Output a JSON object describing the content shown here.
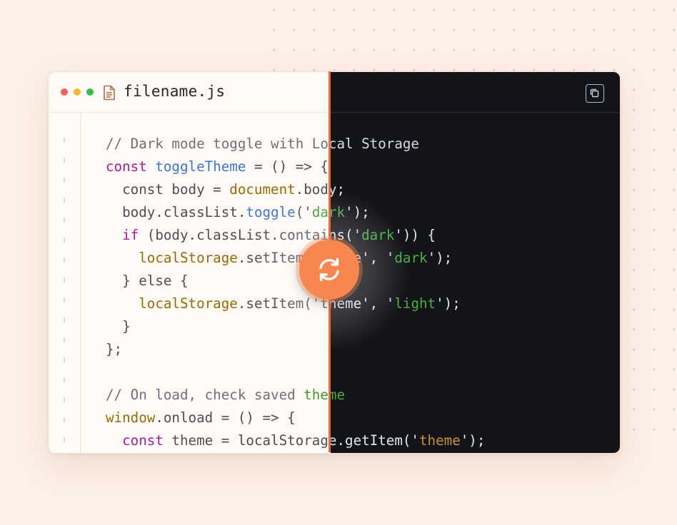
{
  "window": {
    "filename": "filename.js",
    "file_icon": "file-icon",
    "copy_icon": "copy-icon",
    "traffic_lights": [
      "#f0625a",
      "#f5b533",
      "#2fbf55"
    ]
  },
  "toggle": {
    "icon": "refresh-icon",
    "color": "#f8874f",
    "divider_color": "#f06a34"
  },
  "theme_colors": {
    "light_background": "#fffaf6",
    "dark_background": "#13141a",
    "page_background": "#fdf1e8"
  },
  "code": {
    "lines": [
      [
        {
          "t": "// Dark mode toggle with Local Storage",
          "c": "com"
        }
      ],
      [
        {
          "t": "const",
          "c": "kw"
        },
        {
          "t": " "
        },
        {
          "t": "toggleTheme",
          "c": "fn"
        },
        {
          "t": " = () => {"
        }
      ],
      [
        {
          "t": "  const body = "
        },
        {
          "t": "document",
          "c": "obj"
        },
        {
          "t": ".body;"
        }
      ],
      [
        {
          "t": "  body.classList."
        },
        {
          "t": "toggle",
          "c": "fn"
        },
        {
          "t": "('"
        },
        {
          "t": "dark",
          "c": "str"
        },
        {
          "t": "');"
        }
      ],
      [
        {
          "t": "  "
        },
        {
          "t": "if",
          "c": "kw"
        },
        {
          "t": " (body.classList.contains('"
        },
        {
          "t": "dark",
          "c": "str"
        },
        {
          "t": "')) {"
        }
      ],
      [
        {
          "t": "    "
        },
        {
          "t": "localStorage",
          "c": "obj"
        },
        {
          "t": ".setItem('theme', '"
        },
        {
          "t": "dark",
          "c": "str"
        },
        {
          "t": "');"
        }
      ],
      [
        {
          "t": "  } else {"
        }
      ],
      [
        {
          "t": "    "
        },
        {
          "t": "localStorage",
          "c": "obj"
        },
        {
          "t": ".setItem('theme', '"
        },
        {
          "t": "light",
          "c": "str"
        },
        {
          "t": "');"
        }
      ],
      [
        {
          "t": "  }"
        }
      ],
      [
        {
          "t": "};"
        }
      ],
      [
        {
          "t": ""
        }
      ],
      [
        {
          "t": "// On load, check saved ",
          "c": "com"
        },
        {
          "t": "theme",
          "c": "str"
        }
      ],
      [
        {
          "t": "window",
          "c": "obj"
        },
        {
          "t": ".onload = () => {"
        }
      ],
      [
        {
          "t": "  "
        },
        {
          "t": "const",
          "c": "kw"
        },
        {
          "t": " theme = localStorage.getItem('"
        },
        {
          "t": "theme",
          "c": "str2"
        },
        {
          "t": "');"
        }
      ]
    ]
  }
}
